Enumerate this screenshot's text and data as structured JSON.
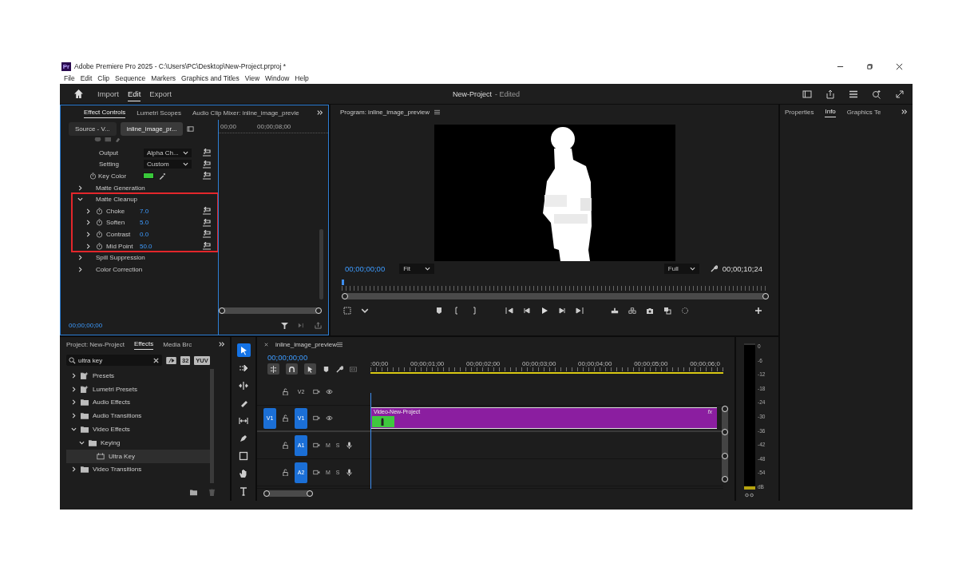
{
  "window": {
    "logo": "Pr",
    "title": "Adobe Premiere Pro 2025 - C:\\Users\\PC\\Desktop\\New-Project.prproj *"
  },
  "menu": [
    "File",
    "Edit",
    "Clip",
    "Sequence",
    "Markers",
    "Graphics and Titles",
    "View",
    "Window",
    "Help"
  ],
  "workspaces": [
    {
      "label": "Import",
      "selected": false
    },
    {
      "label": "Edit",
      "selected": true
    },
    {
      "label": "Export",
      "selected": false
    }
  ],
  "document": {
    "name": "New-Project",
    "status": "- Edited"
  },
  "effect_controls": {
    "tabs": [
      {
        "label": "Effect Controls",
        "selected": true
      },
      {
        "label": "Lumetri Scopes",
        "selected": false
      },
      {
        "label": "Audio Clip Mixer: inline_image_previe",
        "selected": false
      }
    ],
    "sources": [
      {
        "label": "Source - V...",
        "selected": false
      },
      {
        "label": "inline_image_pr...",
        "selected": true
      }
    ],
    "ruler": [
      "00;00",
      "00;00;08;00"
    ],
    "properties": [
      {
        "kind": "dropdown",
        "label": "Output",
        "value": "Alpha Ch..."
      },
      {
        "kind": "dropdown",
        "label": "Setting",
        "value": "Custom"
      },
      {
        "kind": "color",
        "label": "Key Color",
        "color": "#39c83a"
      },
      {
        "kind": "group",
        "label": "Matte Generation",
        "expanded": false,
        "highlighted": false
      },
      {
        "kind": "group",
        "label": "Matte Cleanup",
        "expanded": true,
        "highlighted": true,
        "children": [
          {
            "label": "Choke",
            "value": "7.0"
          },
          {
            "label": "Soften",
            "value": "5.0"
          },
          {
            "label": "Contrast",
            "value": "0.0"
          },
          {
            "label": "Mid Point",
            "value": "50.0"
          }
        ]
      },
      {
        "kind": "group",
        "label": "Spill Suppression",
        "expanded": false,
        "highlighted": false
      },
      {
        "kind": "group",
        "label": "Color Correction",
        "expanded": false,
        "highlighted": false
      }
    ],
    "timecode": "00;00;00;00"
  },
  "program": {
    "title": "Program: inline_image_preview",
    "timecode": "00;00;00;00",
    "zoom": "Fit",
    "quality": "Full",
    "duration": "00;00;10;24"
  },
  "right_panel": {
    "tabs": [
      {
        "label": "Properties",
        "selected": false
      },
      {
        "label": "Info",
        "selected": true
      },
      {
        "label": "Graphics Te",
        "selected": false
      }
    ]
  },
  "project": {
    "tabs": [
      {
        "label": "Project: New-Project",
        "selected": false
      },
      {
        "label": "Effects",
        "selected": true
      },
      {
        "label": "Media Brc",
        "selected": false
      }
    ],
    "search": {
      "value": "ultra key"
    },
    "badges": [
      "32",
      "YUV"
    ],
    "tree": [
      {
        "label": "Presets",
        "kind": "preset-folder",
        "expanded": false,
        "selected": false
      },
      {
        "label": "Lumetri Presets",
        "kind": "preset-folder",
        "expanded": false,
        "selected": false
      },
      {
        "label": "Audio Effects",
        "kind": "folder",
        "expanded": false,
        "selected": false
      },
      {
        "label": "Audio Transitions",
        "kind": "folder",
        "expanded": false,
        "selected": false
      },
      {
        "label": "Video Effects",
        "kind": "folder",
        "expanded": true,
        "selected": false,
        "children": [
          {
            "label": "Keying",
            "kind": "folder",
            "expanded": true,
            "selected": false,
            "children": [
              {
                "label": "Ultra Key",
                "kind": "effect",
                "selected": true
              }
            ]
          }
        ]
      },
      {
        "label": "Video Transitions",
        "kind": "folder",
        "expanded": false,
        "selected": false
      }
    ]
  },
  "tools": [
    {
      "kind": "selection",
      "selected": true
    },
    {
      "kind": "track-select",
      "selected": false
    },
    {
      "kind": "ripple",
      "selected": false
    },
    {
      "kind": "razor",
      "selected": false
    },
    {
      "kind": "slip",
      "selected": false
    },
    {
      "kind": "pen",
      "selected": false
    },
    {
      "kind": "rectangle",
      "selected": false
    },
    {
      "kind": "hand",
      "selected": false
    },
    {
      "kind": "type",
      "selected": false
    }
  ],
  "timeline": {
    "title": "inline_image_preview",
    "timecode": "00;00;00;00",
    "ruler": [
      ":00;00",
      "00;00;01;00",
      "00;00;02;00",
      "00;00;03;00",
      "00;00;04;00",
      "00;00;05;00",
      "00;00;06;0"
    ],
    "tracks": [
      {
        "kind": "video",
        "name": "V2",
        "targeted": false
      },
      {
        "kind": "video",
        "name": "V1",
        "targeted": true,
        "source": "V1",
        "clip": {
          "title": "Video-New-Project",
          "fx": "fx"
        }
      },
      {
        "kind": "audio",
        "name": "A1",
        "targeted": true,
        "mute": "M",
        "solo": "S"
      },
      {
        "kind": "audio",
        "name": "A2",
        "targeted": true,
        "mute": "M",
        "solo": "S"
      }
    ]
  },
  "audio_meter": {
    "scale": [
      "0",
      "-6",
      "-12",
      "-18",
      "-24",
      "-30",
      "-36",
      "-42",
      "-48",
      "-54",
      "dB"
    ]
  }
}
